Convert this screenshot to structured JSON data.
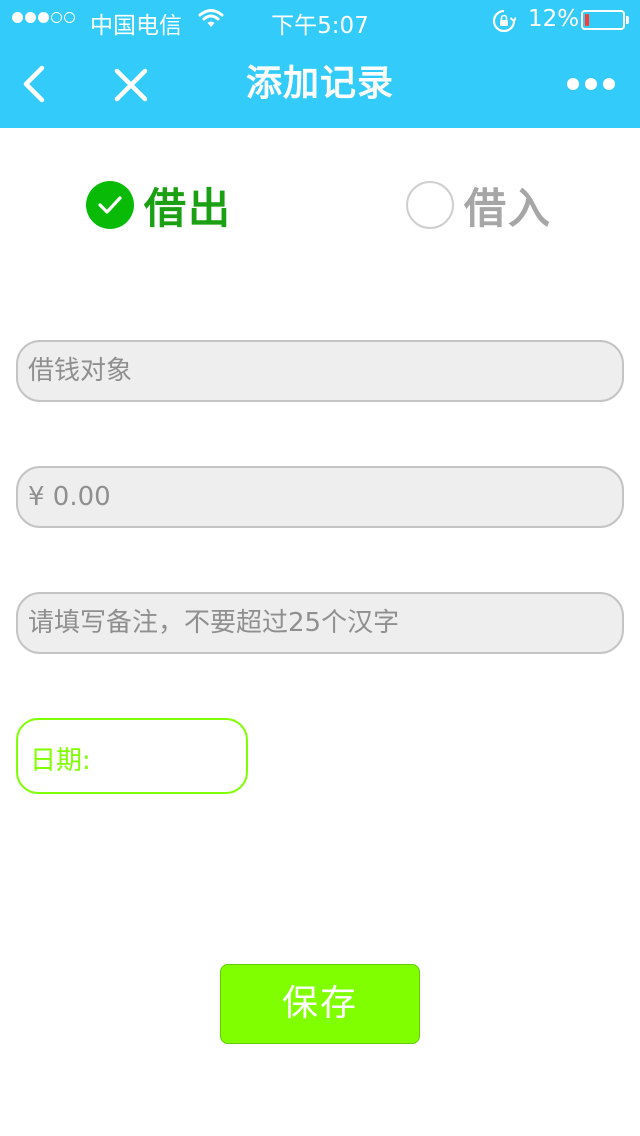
{
  "status_bar": {
    "carrier": "中国电信",
    "time": "下午5:07",
    "battery": "12%",
    "battery_level": 0.12,
    "signal_bars_filled": 3,
    "signal_bars_total": 5,
    "icons": [
      "signal-dots-icon",
      "wifi-icon",
      "rotation-lock-icon",
      "battery-icon"
    ]
  },
  "nav": {
    "title": "添加记录",
    "back_icon": "chevron-left-icon",
    "close_icon": "close-icon",
    "more_icon": "more-dots-icon"
  },
  "type_selector": {
    "selected": "lend",
    "options": [
      {
        "id": "lend",
        "label": "借出",
        "checked": true
      },
      {
        "id": "borrow",
        "label": "借入",
        "checked": false
      }
    ]
  },
  "form": {
    "person": {
      "placeholder": "借钱对象",
      "value": ""
    },
    "amount": {
      "placeholder": "¥ 0.00",
      "value": ""
    },
    "note": {
      "placeholder": "请填写备注，不要超过25个汉字",
      "value": ""
    },
    "date": {
      "label": "日期:",
      "value": ""
    }
  },
  "actions": {
    "save_label": "保存"
  },
  "colors": {
    "header": "#33cbfa",
    "checked": "#09bb07",
    "lend_text": "#1aa012",
    "accent_green": "#7fff00",
    "battery_low": "#ff3b30"
  }
}
